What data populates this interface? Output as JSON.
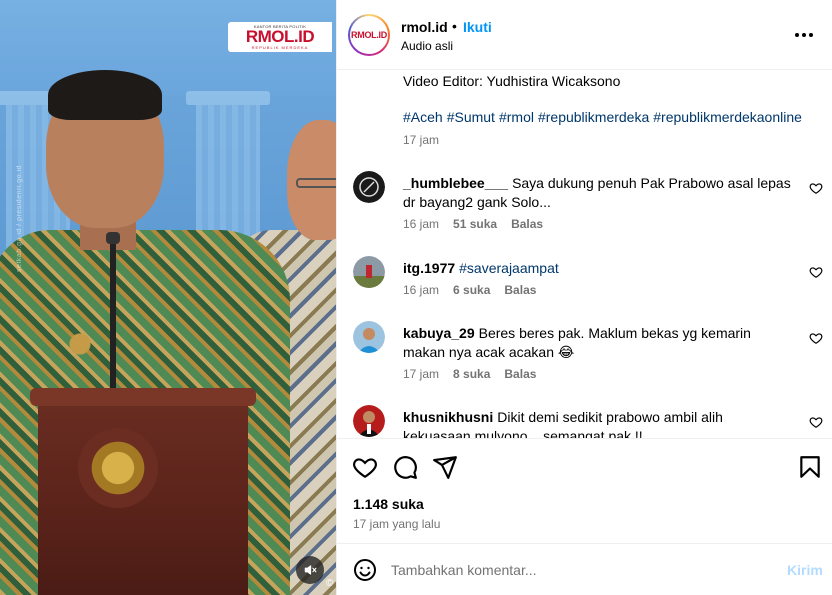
{
  "media": {
    "logo_text": "RMOL.ID",
    "logo_small": "KANTOR BERITA POLITIK",
    "logo_sub": "REPUBLIK MERDEKA",
    "watermark": "setkab.go.id / presidenri.go.id",
    "copyright": "©"
  },
  "header": {
    "username": "rmol.id",
    "dot": "•",
    "follow_label": "Ikuti",
    "audio_label": "Audio asli",
    "avatar_text": "RMOL.ID"
  },
  "caption": {
    "editor_line": "Video Editor: Yudhistira Wicaksono",
    "hashtags": [
      "#Aceh",
      "#Sumut",
      "#rmol",
      "#republikmerdeka",
      "#republikmerdekaonline"
    ],
    "time": "17 jam"
  },
  "comments": [
    {
      "username": "_humblebee___",
      "text": "Saya dukung penuh Pak Prabowo asal lepas dr bayang2 gank Solo...",
      "tag": "",
      "time": "16 jam",
      "likes": "51 suka",
      "reply": "Balas"
    },
    {
      "username": "itg.1977",
      "text": "",
      "tag": "#saverajaampat",
      "time": "16 jam",
      "likes": "6 suka",
      "reply": "Balas"
    },
    {
      "username": "kabuya_29",
      "text": "Beres beres pak. Maklum bekas yg kemarin makan nya acak acakan 😂",
      "tag": "",
      "time": "17 jam",
      "likes": "8 suka",
      "reply": "Balas"
    },
    {
      "username": "khusnikhusni",
      "text": "Dikit demi sedikit prabowo ambil alih kekuasaan mulyono... semangat pak !!",
      "tag": "",
      "time": "",
      "likes": "",
      "reply": ""
    }
  ],
  "actions": {
    "likes": "1.148 suka",
    "posted": "17 jam yang lalu"
  },
  "composer": {
    "placeholder": "Tambahkan komentar...",
    "send_label": "Kirim"
  },
  "colors": {
    "link_blue": "#0095f6",
    "hashtag": "#00376b",
    "muted": "#737373",
    "send_disabled": "#b3dbff"
  }
}
